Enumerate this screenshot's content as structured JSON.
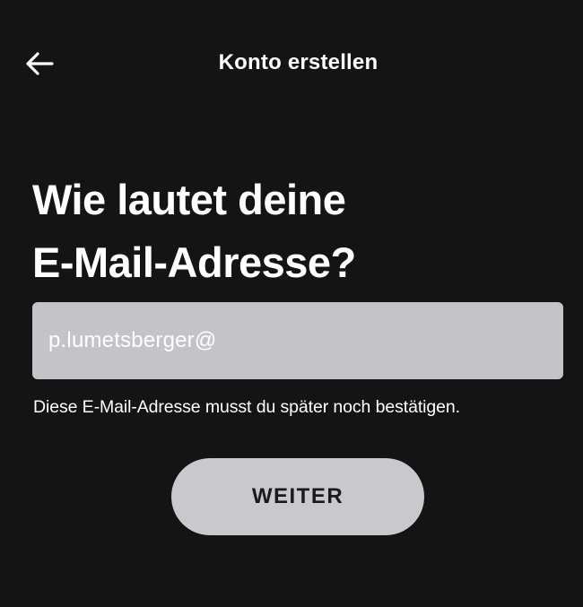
{
  "header": {
    "back_icon": "arrow-left-icon",
    "title": "Konto erstellen"
  },
  "main": {
    "heading_line1": "Wie lautet deine",
    "heading_line2": "E-Mail-Adresse?",
    "email_value": "p.lumetsberger@",
    "hint": "Diese E-Mail-Adresse musst du später noch bestätigen.",
    "continue_label": "WEITER"
  },
  "colors": {
    "background": "#141414",
    "field_background": "#c4c4c8",
    "button_background": "#c9c9cd",
    "text": "#ffffff"
  }
}
